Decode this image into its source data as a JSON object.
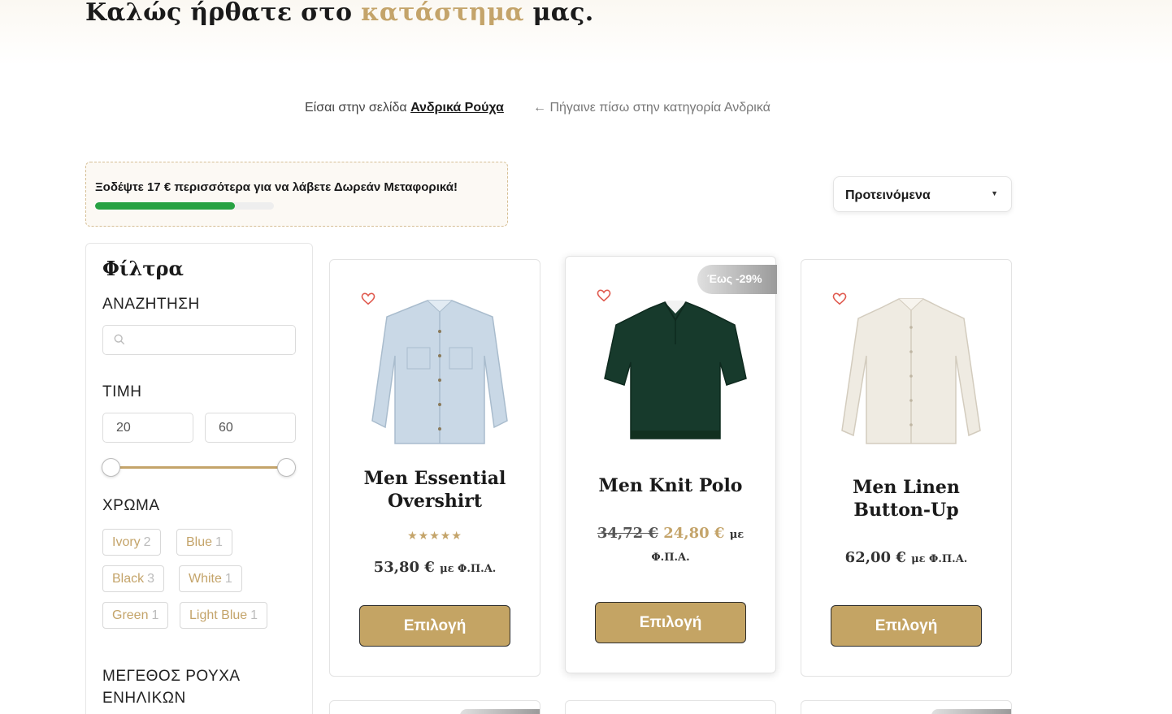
{
  "hero": {
    "title_before": "Καλώς ήρθατε στο",
    "title_accent": "κατάστημα",
    "title_after": "μας."
  },
  "breadcrumb": {
    "prefix": "Είσαι στην σελίδα",
    "current": "Ανδρικά Ρούχα",
    "back": "← Πήγαινε πίσω στην κατηγορία Ανδρικά"
  },
  "shipping": {
    "message": "Ξοδέψτε 17 € περισσότερα για να λάβετε Δωρεάν Μεταφορικά!",
    "progress": 0.78
  },
  "sort": {
    "selected": "Προτεινόμενα"
  },
  "filters": {
    "title": "Φίλτρα",
    "search_heading": "ΑΝΑΖΗΤΗΣΗ",
    "search_placeholder": "",
    "price_heading": "ΤΙΜΗ",
    "price_min": "20",
    "price_max": "60",
    "color_heading": "ΧΡΩΜΑ",
    "colors": [
      {
        "label": "Ivory",
        "count": "2"
      },
      {
        "label": "Blue",
        "count": "1"
      },
      {
        "label": "Black",
        "count": "3"
      },
      {
        "label": "White",
        "count": "1"
      },
      {
        "label": "Green",
        "count": "1"
      },
      {
        "label": "Light Blue",
        "count": "1"
      }
    ],
    "size_heading_line1": "ΜΕΓΕΘΟΣ ΡΟΥΧΑ",
    "size_heading_line2": "ΕΝΗΛΙΚΩΝ"
  },
  "products": [
    {
      "name_line1": "Men Essential",
      "name_line2": "Overshirt",
      "rating": 5,
      "stars": "★★★★★",
      "price": "53,80 €",
      "vat": "με Φ.Π.Α.",
      "button": "Επιλογή"
    },
    {
      "name_line1": "Men Knit Polo",
      "badge": "Έως -29%",
      "old_price": "34,72 €",
      "price": "24,80 €",
      "vat": "με",
      "vat2": "Φ.Π.Α.",
      "button": "Επιλογή"
    },
    {
      "name_line1": "Men Linen",
      "name_line2": "Button-Up",
      "price": "62,00 €",
      "vat": "με Φ.Π.Α.",
      "button": "Επιλογή"
    }
  ],
  "colors": {
    "accent": "#c4a46a",
    "button": "#c4a464",
    "progress": "#27a243",
    "heart": "#e05a4f"
  }
}
